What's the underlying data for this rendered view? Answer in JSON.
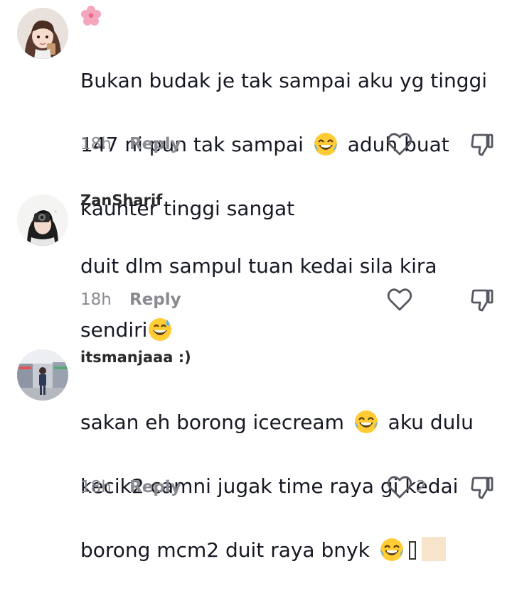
{
  "comments": [
    {
      "username": "",
      "line1": "Bukan budak je tak sampai aku yg tinggi",
      "line2a": "147 ni pun tak sampai",
      "line2b": "aduh buat",
      "line3": "kaunter tinggi sangat",
      "time": "18h",
      "reply_label": "Reply",
      "like_count": "",
      "avatar_icon": "girl-cartoon-avatar",
      "badge_icon": "cherry-blossom-icon"
    },
    {
      "username": "ZanSharif",
      "line1": "duit dlm sampul tuan kedai sila kira",
      "line2": "sendiri",
      "time": "18h",
      "reply_label": "Reply",
      "like_count": "",
      "avatar_icon": "camera-girl-avatar"
    },
    {
      "username": "itsmanjaaa :)",
      "line1a": "sakan eh borong icecream",
      "line1b": "aku dulu",
      "line2": "kecik2 camni jugak time raya gi kedai",
      "line3": "borong mcm2 duit raya bnyk",
      "time": "18h",
      "reply_label": "Reply",
      "like_count": "2",
      "avatar_icon": "store-photo-avatar"
    }
  ],
  "colors": {
    "text": "#161823",
    "muted": "#8a8b91",
    "emoji_face": "#ffcc33"
  }
}
